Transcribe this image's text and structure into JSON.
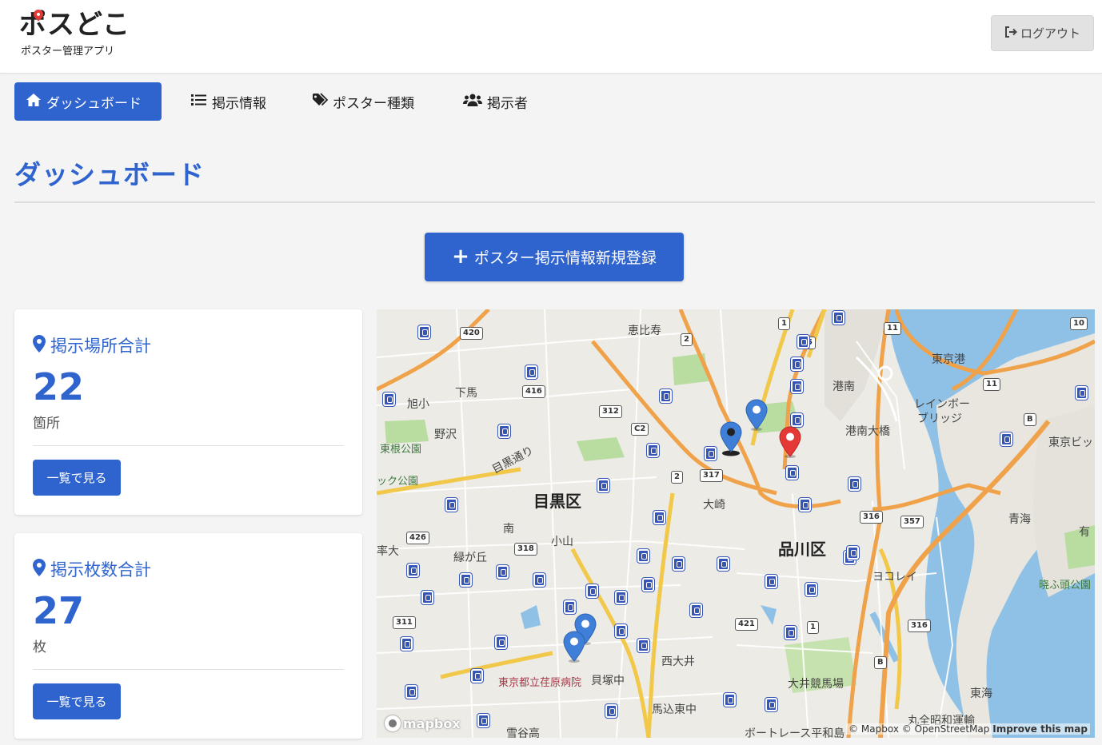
{
  "header": {
    "logo_text": "ポスどこ",
    "logo_subtitle": "ポスター管理アプリ",
    "logout_label": "ログアウト"
  },
  "nav": {
    "items": [
      {
        "label": "ダッシュボード",
        "icon": "home-icon",
        "active": true
      },
      {
        "label": "掲示情報",
        "icon": "list-icon",
        "active": false
      },
      {
        "label": "ポスター種類",
        "icon": "tags-icon",
        "active": false
      },
      {
        "label": "掲示者",
        "icon": "users-icon",
        "active": false
      }
    ]
  },
  "page": {
    "title": "ダッシュボード",
    "new_button_label": "ポスター掲示情報新規登録"
  },
  "stats": [
    {
      "label": "掲示場所合計",
      "value": "22",
      "unit": "箇所",
      "button_label": "一覧で見る"
    },
    {
      "label": "掲示枚数合計",
      "value": "27",
      "unit": "枚",
      "button_label": "一覧で見る"
    }
  ],
  "map": {
    "district_labels": [
      "目黒区",
      "品川区"
    ],
    "place_labels": [
      "恵比寿",
      "下馬",
      "旭小",
      "野沢",
      "東根公園",
      "ック公園",
      "目黒通り",
      "南",
      "小山",
      "率大",
      "緑が丘",
      "大崎",
      "港南",
      "港南大橋",
      "東京港",
      "レインボー",
      "ブリッジ",
      "東京ビッ",
      "青海",
      "晓ふ頭公園",
      "ヨコレイ",
      "西大井",
      "大井競馬場",
      "東海",
      "貝塚中",
      "東京都立荏原病院",
      "馬込東中",
      "雪谷高",
      "丸全昭和運輸",
      "ボートレース平和島",
      "有"
    ],
    "road_shields": [
      "420",
      "416",
      "312",
      "C2",
      "2",
      "317",
      "1",
      "15",
      "11",
      "10",
      "B",
      "316",
      "357",
      "426",
      "318",
      "311",
      "421",
      "11"
    ],
    "attribution": "© Mapbox © OpenStreetMap",
    "improve_label": "Improve this map",
    "logo_text": "mapbox",
    "marker_colors": {
      "default": "#3f7fd8",
      "selected": "#e53935"
    }
  }
}
